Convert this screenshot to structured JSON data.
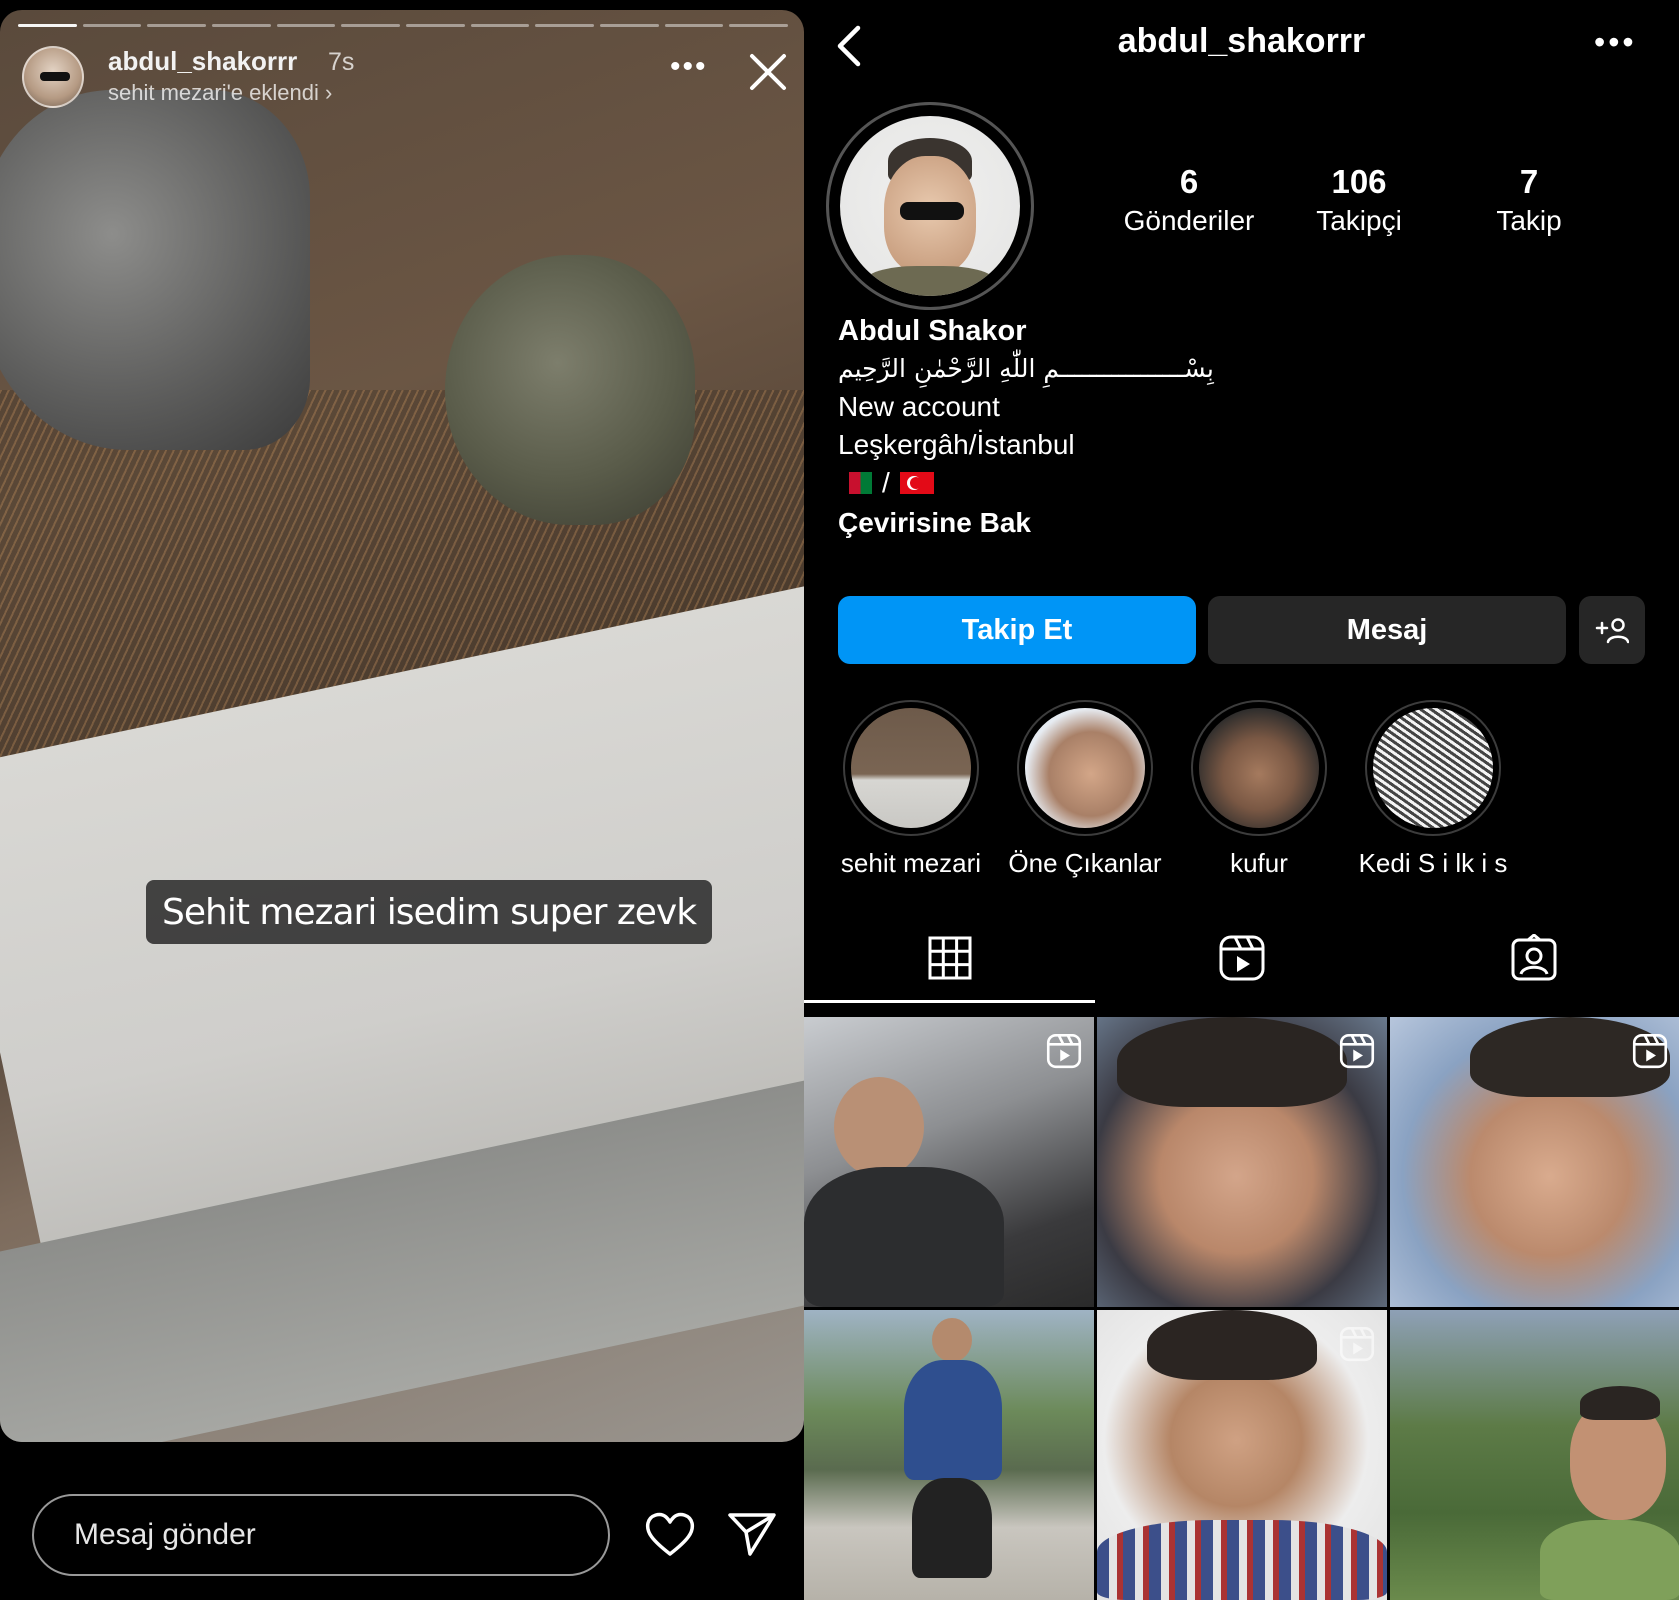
{
  "story": {
    "username": "abdul_shakorrr",
    "time": "7s",
    "added_to": "sehit mezari'e eklendi",
    "caption": "Sehit mezari isedim super zevk",
    "message_placeholder": "Mesaj gönder",
    "progress_segments_total": 12,
    "progress_segments_done": 1,
    "icons": {
      "more": "more-horizontal-icon",
      "close": "close-icon",
      "like": "heart-icon",
      "send": "send-icon"
    }
  },
  "profile": {
    "header": {
      "username": "abdul_shakorrr",
      "back_icon": "chevron-left-icon",
      "more_icon": "more-horizontal-icon"
    },
    "stats": [
      {
        "value": "6",
        "label": "Gönderiler"
      },
      {
        "value": "106",
        "label": "Takipçi"
      },
      {
        "value": "7",
        "label": "Takip"
      }
    ],
    "bio": {
      "name": "Abdul Shakor",
      "arabic": "بِسْـــــــــــــــــمِ اللّٰهِ الرَّحْمٰنِ الرَّحِيم",
      "line1": "New account",
      "location": "Leşkergâh/İstanbul",
      "flags_separator": "/",
      "flags": [
        "flag-afghanistan",
        "flag-turkey"
      ],
      "translate": "Çevirisine Bak"
    },
    "buttons": {
      "follow": "Takip Et",
      "message": "Mesaj",
      "add_person": "+👤"
    },
    "colors": {
      "follow": "#0095f6",
      "secondary_button": "#262626",
      "background": "#000000"
    },
    "highlights": [
      {
        "label": "sehit mezari"
      },
      {
        "label": "Öne Çıkanlar"
      },
      {
        "label": "kufur"
      },
      {
        "label": "Kedi S i lk i s"
      }
    ],
    "tabs": [
      "grid-icon",
      "reels-icon",
      "tagged-icon"
    ],
    "posts": [
      {
        "type": "reel"
      },
      {
        "type": "reel"
      },
      {
        "type": "reel"
      },
      {
        "type": "photo"
      },
      {
        "type": "reel"
      },
      {
        "type": "photo"
      }
    ]
  }
}
